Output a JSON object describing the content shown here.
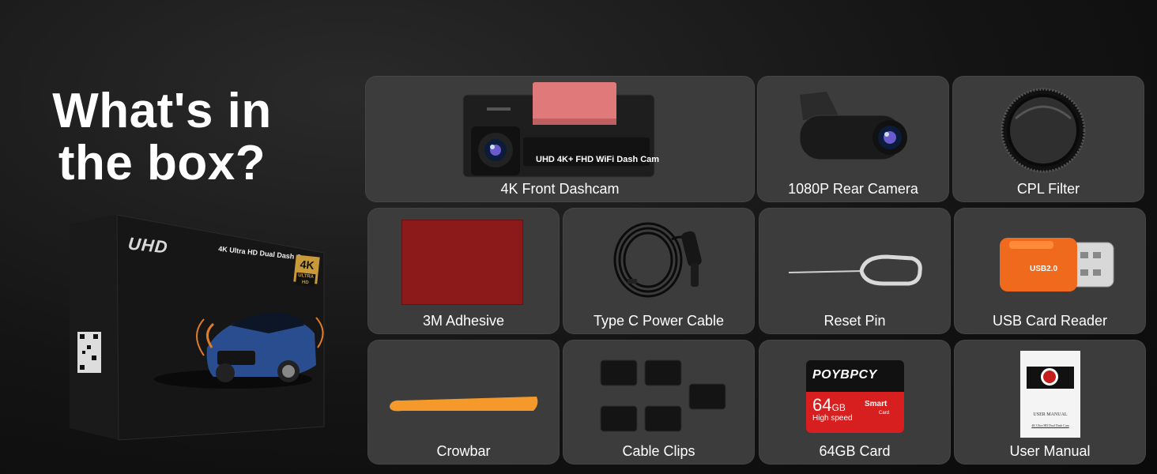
{
  "headline": {
    "line1": "What's in",
    "line2": "the box?"
  },
  "retail_box": {
    "brand": "UHD",
    "title": "4K Ultra HD Dual Dash Cam",
    "badge": "4K",
    "badge_sub": "ULTRA HD"
  },
  "items": {
    "front_dashcam": {
      "label": "4K Front Dashcam",
      "sticker": "UHD 4K+ FHD WiFi Dash Cam"
    },
    "rear_camera": {
      "label": "1080P Rear Camera"
    },
    "cpl_filter": {
      "label": "CPL Filter"
    },
    "adhesive": {
      "label": "3M Adhesive"
    },
    "power_cable": {
      "label": "Type C Power Cable"
    },
    "reset_pin": {
      "label": "Reset Pin"
    },
    "card_reader": {
      "label": "USB Card Reader",
      "text": "USB2.0"
    },
    "crowbar": {
      "label": "Crowbar"
    },
    "cable_clips": {
      "label": "Cable Clips"
    },
    "sd_card": {
      "label": "64GB Card",
      "brand": "POYBPCY",
      "size": "64",
      "unit": "GB",
      "speed": "High speed",
      "smart": "Smart",
      "card_word": "Card"
    },
    "user_manual": {
      "label": "User Manual",
      "title": "USER MANUAL",
      "subtitle": "4K Ultra HD Dual Dash Cam"
    }
  },
  "colors": {
    "tile_bg": "#3c3c3c",
    "adhesive_red": "#8c1a1a",
    "crowbar_orange": "#f59a2a",
    "reader_orange": "#f06a1e",
    "sd_red": "#d81f1f"
  }
}
